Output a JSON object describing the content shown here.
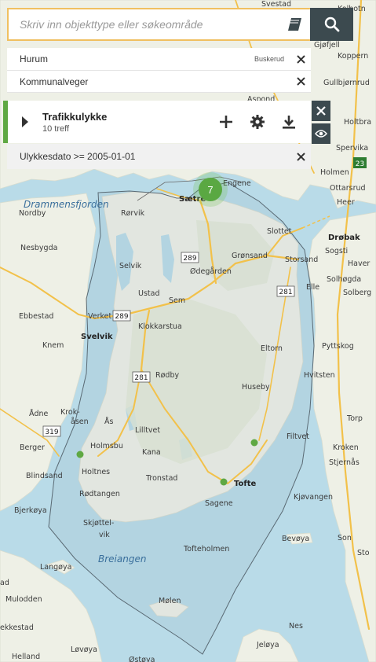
{
  "search": {
    "placeholder": "Skriv inn objekttype eller søkeområde"
  },
  "filters": {
    "area": {
      "label": "Hurum",
      "county": "Buskerud"
    },
    "road_category": {
      "label": "Kommunalveger"
    }
  },
  "layer": {
    "title": "Trafikkulykke",
    "count": "10 treff",
    "accent_color": "#5fa843"
  },
  "condition": {
    "label": "Ulykkesdato >= 2005-01-01"
  },
  "cluster": {
    "count": "7"
  },
  "icons": [
    "book-icon",
    "search-icon",
    "close-icon",
    "expand-arrow-icon",
    "plus-icon",
    "gear-icon",
    "download-icon",
    "eye-icon"
  ],
  "map_labels": {
    "drammensfjorden": "Drammensfjorden",
    "breiangen": "Breiangen",
    "svestad": "Svestad",
    "kolbotn": "Kolbotn",
    "gjofjell": "Gjøfjell",
    "koppern": "Koppern",
    "gullbjornrud": "Gullbjørnrud",
    "holtbra": "Holtbra",
    "aspond": "Aspond",
    "spervika": "Spervika",
    "holmen_e": "Holmen",
    "ottarsrud": "Ottarsrud",
    "heer": "Heer",
    "engene": "Engene",
    "saetre": "Sætre",
    "nordby": "Nordby",
    "rorvik": "Rørvik",
    "slottet": "Slottet",
    "drobak": "Drøbak",
    "sogsti": "Sogsti",
    "haver": "Haver",
    "nesbygda": "Nesbygda",
    "gronsand": "Grønsand",
    "storsand": "Storsand",
    "selvik": "Selvik",
    "odegarden": "Ødegården",
    "elle": "Elle",
    "solhogda": "Solhøgda",
    "solberg": "Solberg",
    "ustad": "Ustad",
    "sem": "Sem",
    "ebbestad": "Ebbestad",
    "verket": "Verket",
    "klokkarstua": "Klokkarstua",
    "svelvik": "Svelvik",
    "pyttskog": "Pyttskog",
    "knem": "Knem",
    "eltorn": "Eltorn",
    "rodby": "Rødby",
    "hvitsten": "Hvitsten",
    "huseby": "Huseby",
    "aadne": "Ådne",
    "krokasen_1": "Krok-",
    "krokasen_2": "åsen",
    "aas": "Ås",
    "torp": "Torp",
    "lilltvet": "Lilltvet",
    "filtvet": "Filtvet",
    "berger": "Berger",
    "holmsbu": "Holmsbu",
    "kana": "Kana",
    "kroken": "Kroken",
    "blindsand": "Blindsand",
    "holtnes": "Holtnes",
    "tronstad": "Tronstad",
    "tofte": "Tofte",
    "stjernas": "Stjernås",
    "rodtangen": "Rødtangen",
    "kjovangen": "Kjøvangen",
    "sagene": "Sagene",
    "bjerkoya": "Bjerkøya",
    "skjottelvik_1": "Skjøttel-",
    "skjottelvik_2": "vik",
    "son": "Son",
    "bevoya": "Bevøya",
    "tofteholmen": "Tofteholmen",
    "langoya": "Langøya",
    "sto": "Sto",
    "ad": "ad",
    "molen": "Mølen",
    "mulodden": "Mulodden",
    "nes": "Nes",
    "ekkestad": "ekkestad",
    "helland": "Helland",
    "lovoya": "Løvøya",
    "ostoya": "Østøya",
    "jeloya": "Jeløya"
  },
  "road_shields": {
    "r289a": "289",
    "r289b": "289",
    "r281a": "281",
    "r281b": "281",
    "r319": "319",
    "e6": "23"
  }
}
